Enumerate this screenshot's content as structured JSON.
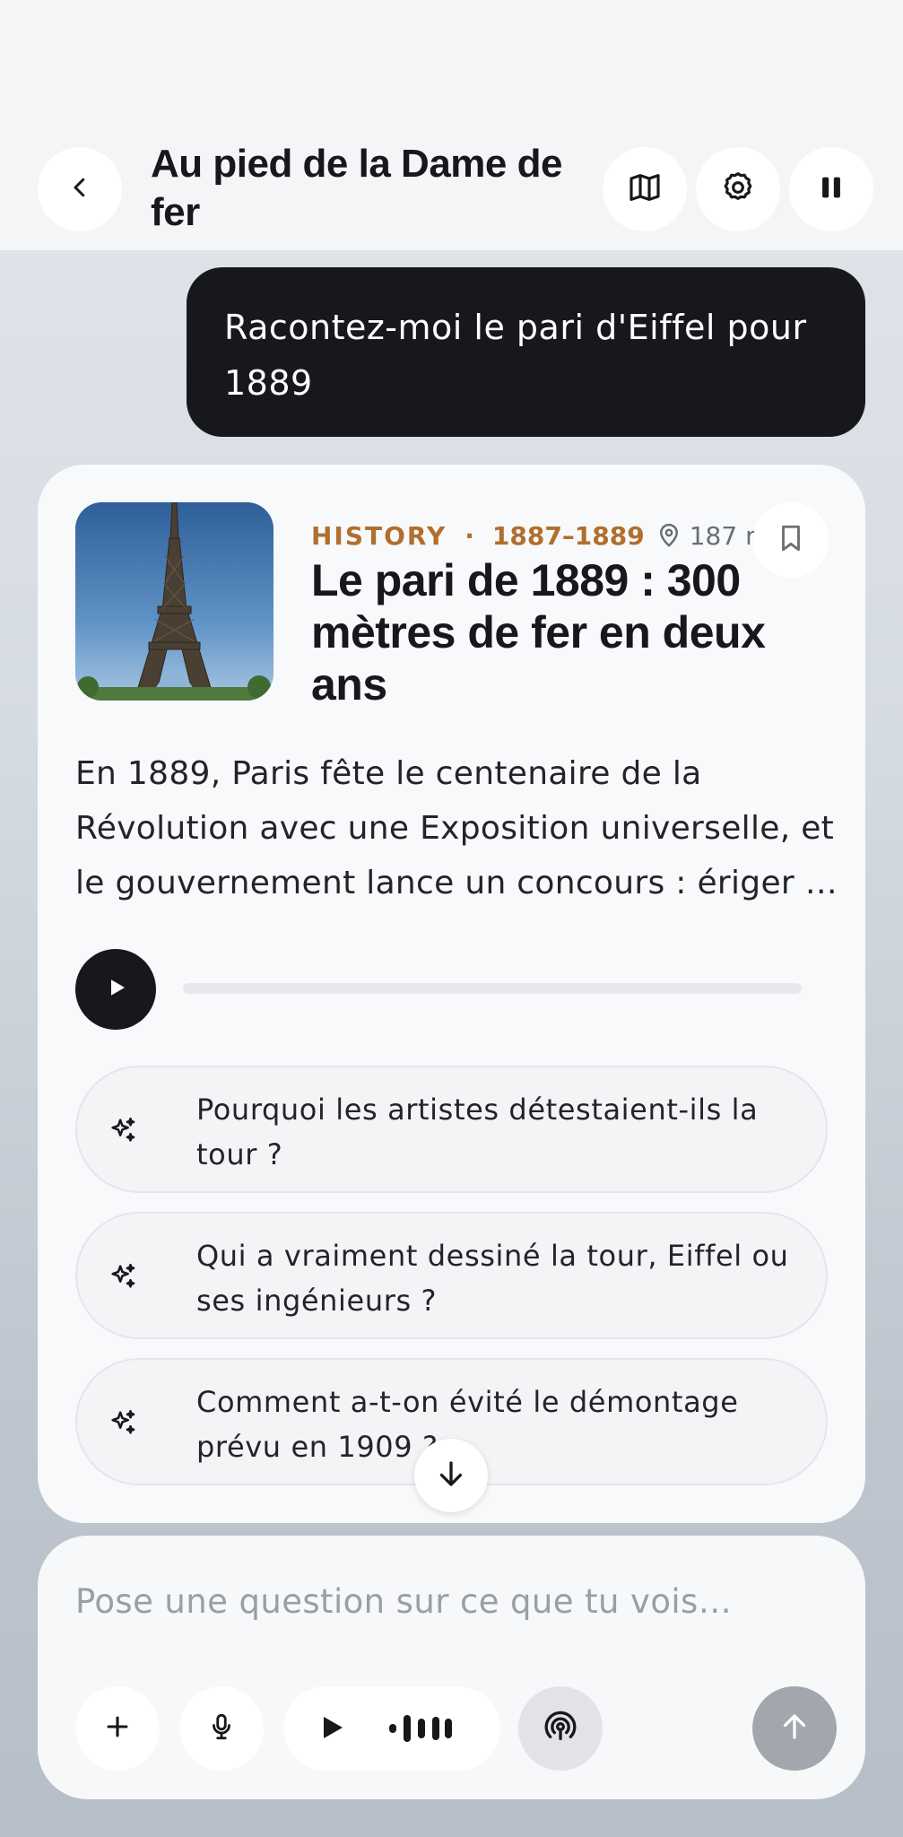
{
  "header": {
    "title": "Au pied de la Dame de fer",
    "back_icon": "chevron-left-icon",
    "map_icon": "map-icon",
    "settings_icon": "gear-icon",
    "pause_icon": "pause-icon"
  },
  "chat": {
    "user_message": "Racontez-moi le pari d'Eiffel pour 1889"
  },
  "story_card": {
    "category": "HISTORY",
    "separator": "·",
    "years": "1887–1889",
    "distance": "187 m",
    "title": "Le pari de 1889 : 300 mètres de fer en deux ans",
    "body": "En 1889, Paris fête le centenaire de la Révolution avec une Exposition universelle, et le gouvernement lance un concours : ériger …",
    "audio_progress": 0,
    "suggestions": [
      {
        "label": "Pourquoi les artistes détestaient-ils la tour ?"
      },
      {
        "label": "Qui a vraiment dessiné la tour, Eiffel ou ses ingénieurs ?"
      },
      {
        "label": "Comment a-t-on évité le démontage prévu en 1909 ?"
      }
    ]
  },
  "composer": {
    "placeholder": "Pose une question sur ce que tu vois…",
    "value": ""
  },
  "colors": {
    "accent": "#b06f2e",
    "dark": "#16181c",
    "send_disabled": "#a3a7ad"
  }
}
